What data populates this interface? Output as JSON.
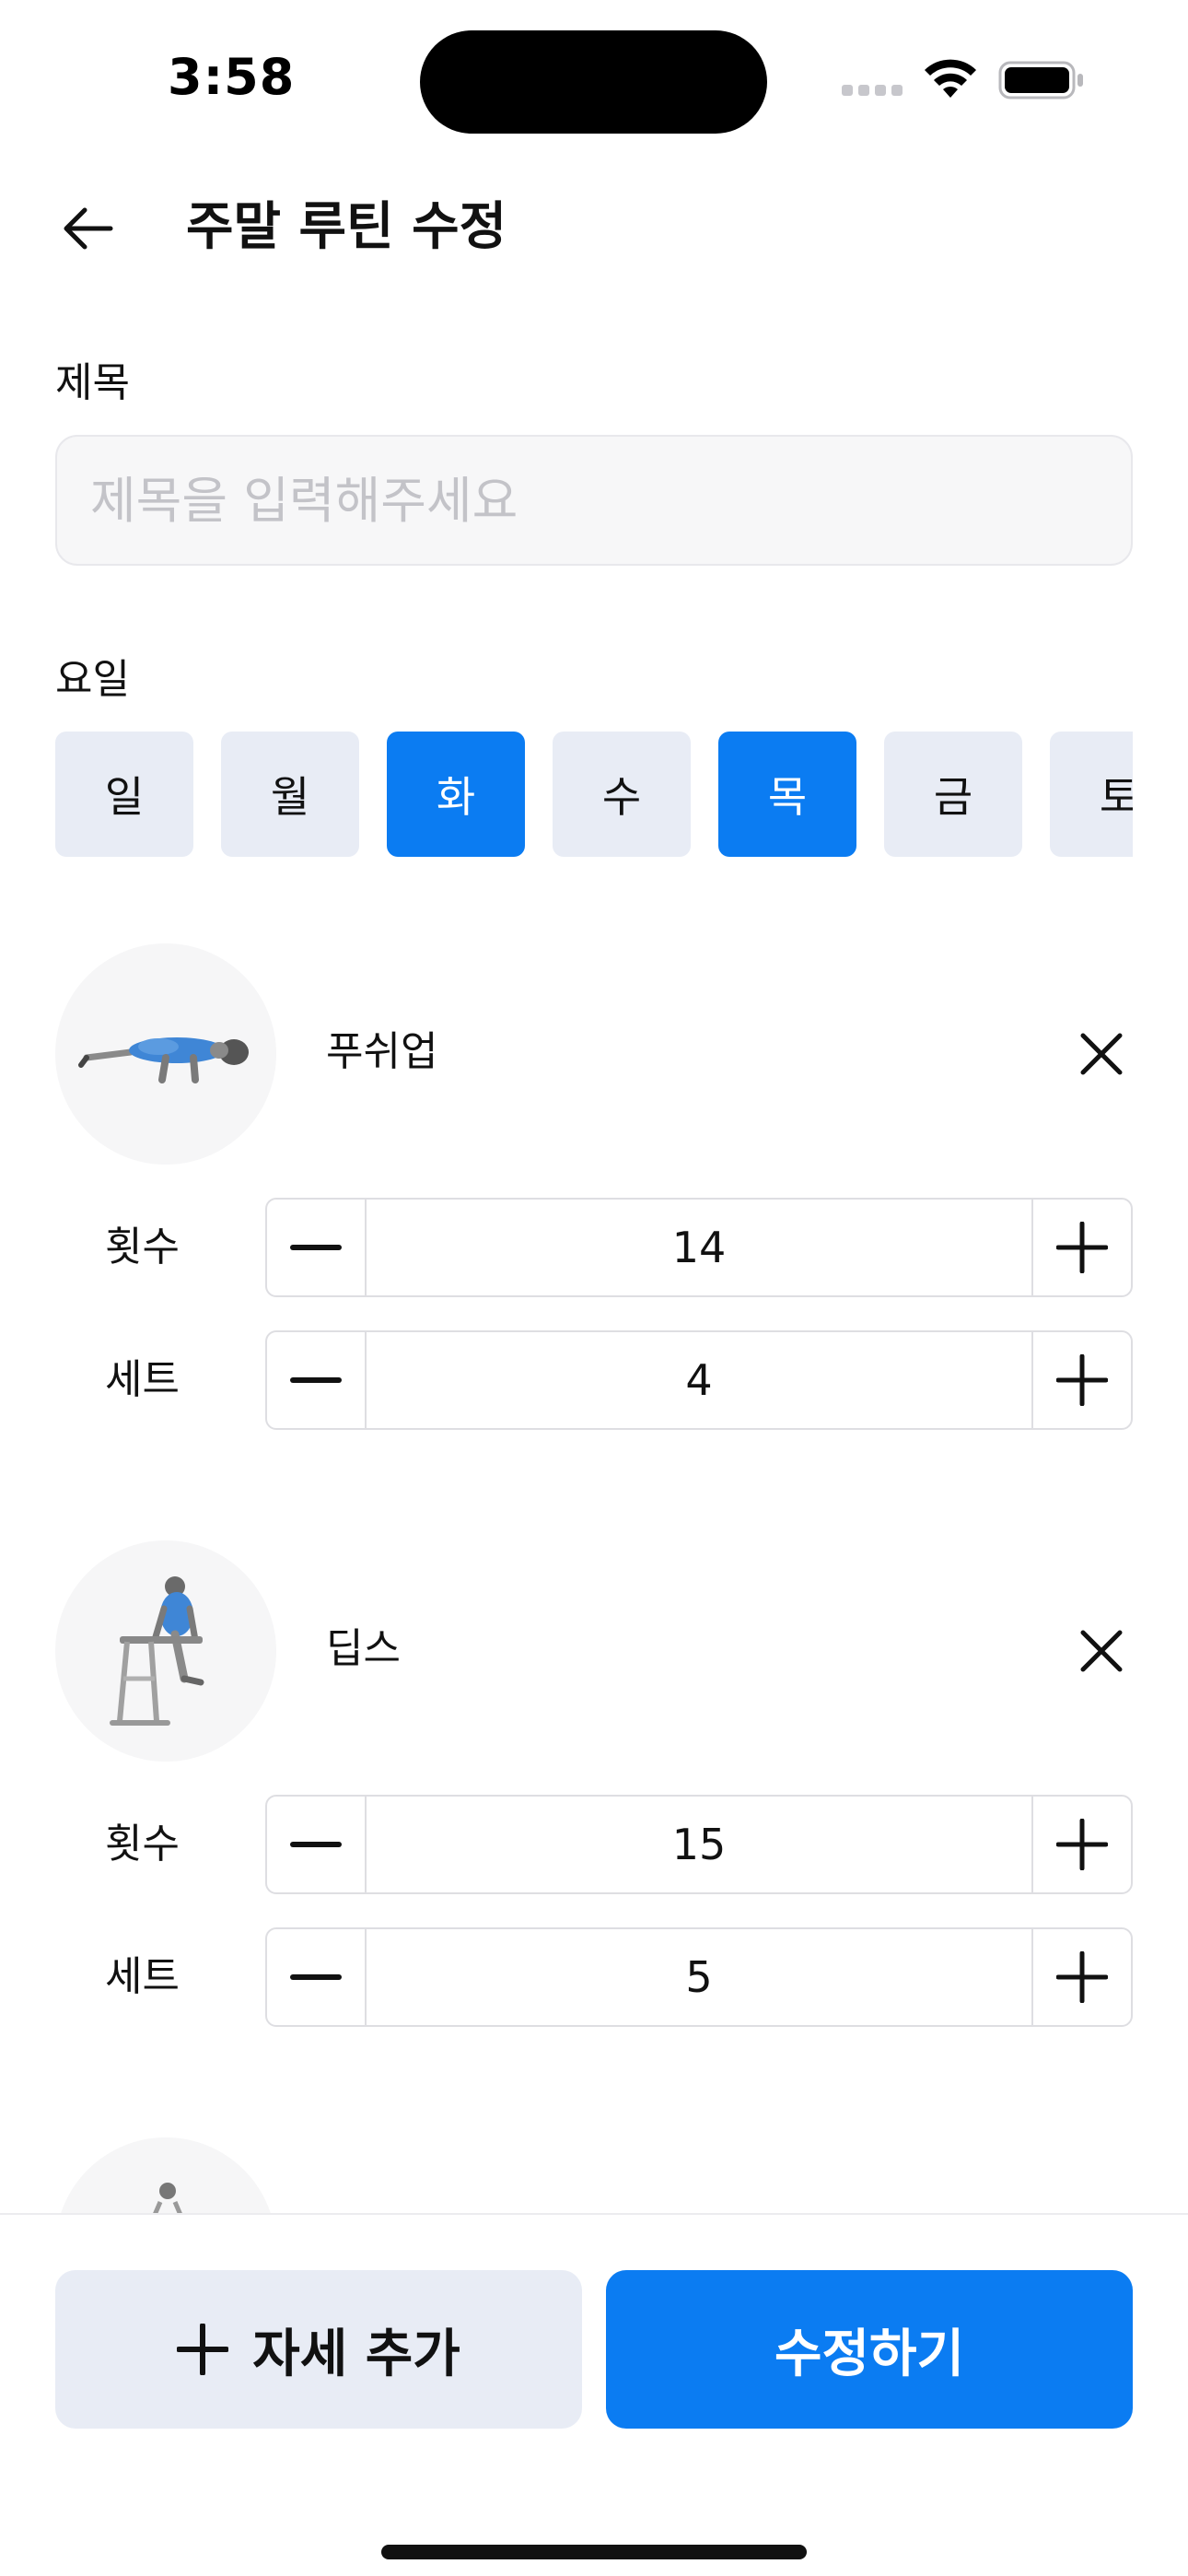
{
  "status_bar": {
    "time": "3:58"
  },
  "header": {
    "title": "주말 루틴 수정"
  },
  "title_field": {
    "label": "제목",
    "placeholder": "제목을 입력해주세요",
    "value": ""
  },
  "days": {
    "label": "요일",
    "items": [
      {
        "label": "일",
        "selected": false
      },
      {
        "label": "월",
        "selected": false
      },
      {
        "label": "화",
        "selected": true
      },
      {
        "label": "수",
        "selected": false
      },
      {
        "label": "목",
        "selected": true
      },
      {
        "label": "금",
        "selected": false
      },
      {
        "label": "토",
        "selected": false
      }
    ]
  },
  "exercises": [
    {
      "name": "푸쉬업",
      "reps_label": "횟수",
      "reps": "14",
      "sets_label": "세트",
      "sets": "4"
    },
    {
      "name": "딥스",
      "reps_label": "횟수",
      "reps": "15",
      "sets_label": "세트",
      "sets": "5"
    }
  ],
  "actions": {
    "add_label": "자세 추가",
    "submit_label": "수정하기"
  },
  "colors": {
    "accent": "#0b7cf2",
    "chip_bg": "#e8ecf5",
    "input_bg": "#f7f7f8"
  }
}
